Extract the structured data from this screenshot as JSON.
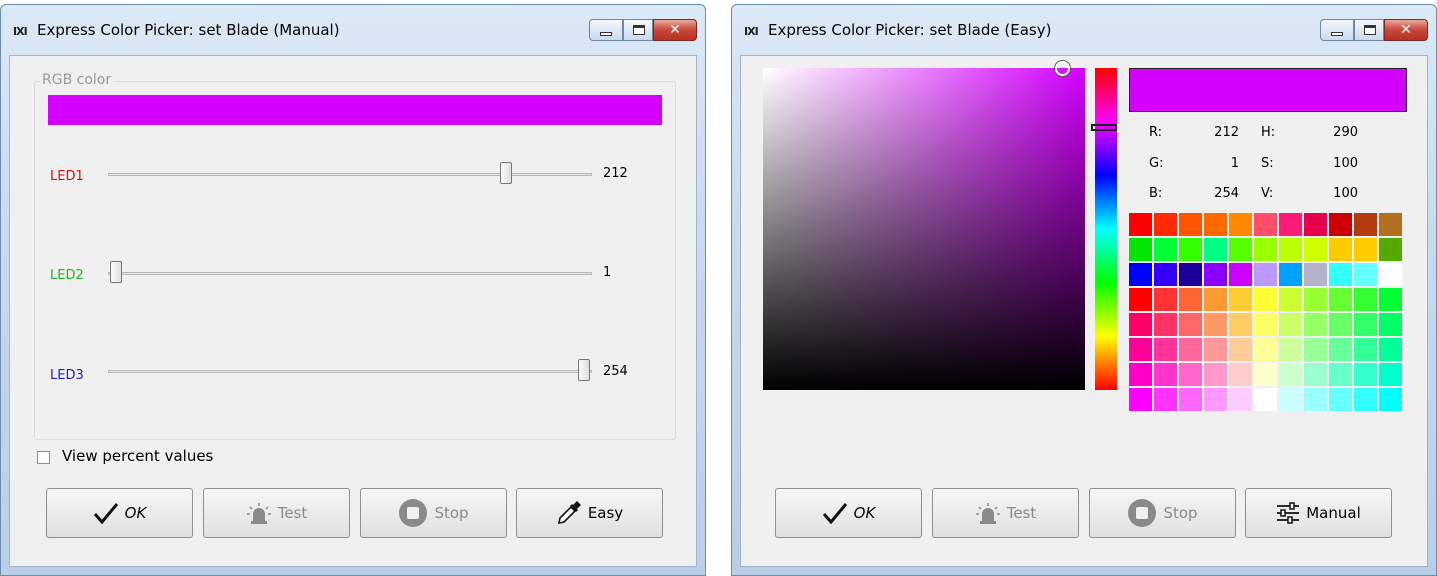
{
  "manual_window": {
    "title": "Express Color Picker: set Blade (Manual)",
    "app_icon": "IXI",
    "group_label": "RGB color",
    "color_hex": "#D400FE",
    "sliders": [
      {
        "label": "LED1",
        "value": "212",
        "level": 212,
        "max": 255,
        "label_color": "#d01010"
      },
      {
        "label": "LED2",
        "value": "1",
        "level": 1,
        "max": 255,
        "label_color": "#22b422"
      },
      {
        "label": "LED3",
        "value": "254",
        "level": 254,
        "max": 255,
        "label_color": "#1e20c8"
      }
    ],
    "checkbox_label": "View percent values",
    "checkbox_checked": false,
    "buttons": {
      "ok": "OK",
      "test": "Test",
      "stop": "Stop",
      "easy": "Easy"
    },
    "close_glyph": "✕"
  },
  "easy_window": {
    "title": "Express Color Picker: set Blade (Easy)",
    "app_icon": "IXI",
    "color_hex": "#D400FE",
    "hue_gradient": "#ff0000,#ff00ff,#0000ff,#00ffff,#00ff00,#ffff00,#ff0000",
    "values": {
      "r_label": "R:",
      "r": "212",
      "g_label": "G:",
      "g": "1",
      "b_label": "B:",
      "b": "254",
      "h_label": "H:",
      "h": "290",
      "s_label": "S:",
      "s": "100",
      "v_label": "V:",
      "v": "100"
    },
    "palette": [
      "#ff0000",
      "#ff2a00",
      "#ff5500",
      "#ff6a00",
      "#ff8800",
      "#ff4d6a",
      "#ff1a75",
      "#e6004c",
      "#cc0000",
      "#b33a0f",
      "#b07020",
      "#00e600",
      "#00ff33",
      "#33ff00",
      "#00ff80",
      "#55ff00",
      "#99ff00",
      "#bbff00",
      "#ccff00",
      "#ffcc00",
      "#ffcc00",
      "#55aa00",
      "#0000ff",
      "#3300ff",
      "#1a0099",
      "#8800ff",
      "#cc00ff",
      "#bb99ff",
      "#00a0ff",
      "#b3b3cc",
      "#33ffff",
      "#66ffff",
      "#ffffff",
      "#ff0000",
      "#ff3333",
      "#ff6633",
      "#ff9933",
      "#ffcc33",
      "#ffff33",
      "#ccff33",
      "#99ff33",
      "#66ff33",
      "#33ff33",
      "#00ff33",
      "#ff0066",
      "#ff3366",
      "#ff6666",
      "#ff9966",
      "#ffcc66",
      "#ffff66",
      "#ccff66",
      "#99ff66",
      "#66ff66",
      "#33ff66",
      "#00ff66",
      "#ff0099",
      "#ff3399",
      "#ff6699",
      "#ff9999",
      "#ffcc99",
      "#ffff99",
      "#ccff99",
      "#99ff99",
      "#66ff99",
      "#33ff99",
      "#00ff99",
      "#ff00cc",
      "#ff33cc",
      "#ff66cc",
      "#ff99cc",
      "#ffcccc",
      "#ffffcc",
      "#ccffcc",
      "#99ffcc",
      "#66ffcc",
      "#33ffcc",
      "#00ffcc",
      "#ff00ff",
      "#ff33ff",
      "#ff66ff",
      "#ff99ff",
      "#ffccff",
      "#ffffff",
      "#ccffff",
      "#99ffff",
      "#66ffff",
      "#33ffff",
      "#00ffff"
    ],
    "buttons": {
      "ok": "OK",
      "test": "Test",
      "stop": "Stop",
      "manual": "Manual"
    },
    "close_glyph": "✕"
  }
}
